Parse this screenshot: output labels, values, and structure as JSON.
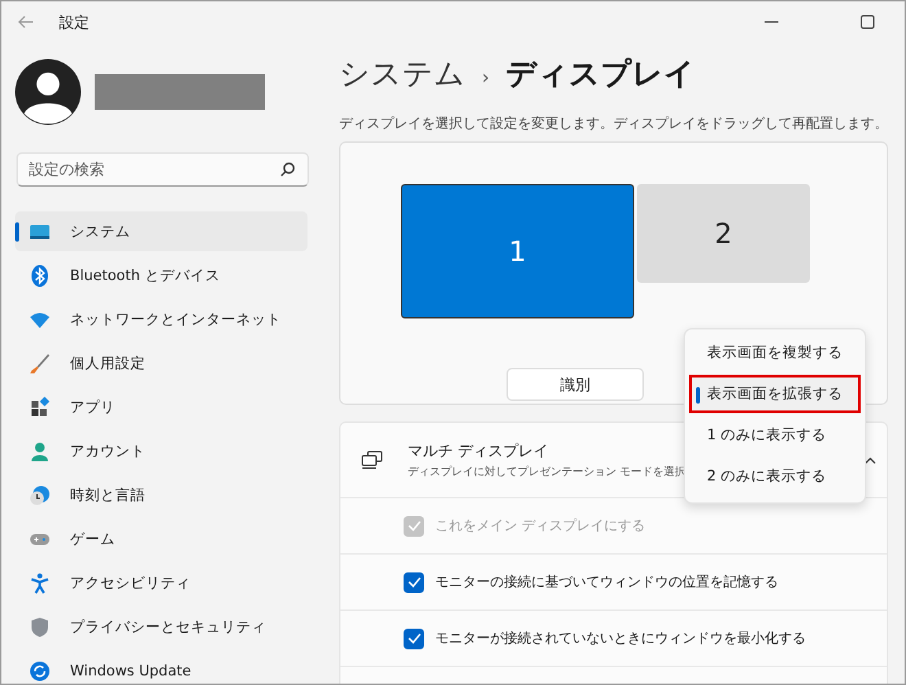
{
  "window": {
    "title": "設定"
  },
  "sidebar": {
    "search": {
      "placeholder": "設定の検索"
    },
    "items": [
      {
        "label": "システム",
        "selected": true
      },
      {
        "label": "Bluetooth とデバイス",
        "selected": false
      },
      {
        "label": "ネットワークとインターネット",
        "selected": false
      },
      {
        "label": "個人用設定",
        "selected": false
      },
      {
        "label": "アプリ",
        "selected": false
      },
      {
        "label": "アカウント",
        "selected": false
      },
      {
        "label": "時刻と言語",
        "selected": false
      },
      {
        "label": "ゲーム",
        "selected": false
      },
      {
        "label": "アクセシビリティ",
        "selected": false
      },
      {
        "label": "プライバシーとセキュリティ",
        "selected": false
      },
      {
        "label": "Windows Update",
        "selected": false
      }
    ]
  },
  "breadcrumb": {
    "parent": "システム",
    "separator": "›",
    "current": "ディスプレイ"
  },
  "description": "ディスプレイを選択して設定を変更します。ディスプレイをドラッグして再配置します。",
  "displays": [
    {
      "label": "1",
      "selected": true
    },
    {
      "label": "2",
      "selected": false
    }
  ],
  "identify_button": "識別",
  "multi_display": {
    "title": "マルチ ディスプレイ",
    "subtitle": "ディスプレイに対してプレゼンテーション モードを選択",
    "expanded": true
  },
  "checkboxes": [
    {
      "label": "これをメイン ディスプレイにする",
      "checked": true,
      "disabled": true
    },
    {
      "label": "モニターの接続に基づいてウィンドウの位置を記憶する",
      "checked": true,
      "disabled": false
    },
    {
      "label": "モニターが接続されていないときにウィンドウを最小化する",
      "checked": true,
      "disabled": false
    }
  ],
  "menu": [
    {
      "label": "表示画面を複製する",
      "selected": false,
      "highlighted": false
    },
    {
      "label": "表示画面を拡張する",
      "selected": true,
      "highlighted": true
    },
    {
      "label": "1 のみに表示する",
      "selected": false,
      "highlighted": false
    },
    {
      "label": "2 のみに表示する",
      "selected": false,
      "highlighted": false
    }
  ]
}
